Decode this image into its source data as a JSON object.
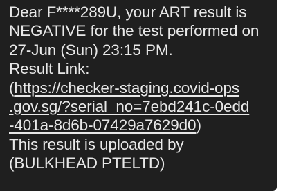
{
  "message": {
    "line1": "Dear F****289U, your ART result is",
    "line2": "NEGATIVE for the test performed on",
    "line3": "27-Jun (Sun) 23:15 PM.",
    "line4": "Result Link:",
    "link_open": "(",
    "link_line1": "https://checker-staging.covid-ops",
    "link_line2": ".gov.sg/?serial_no=7ebd241c-0edd",
    "link_line3": "-401a-8d6b-07429a7629d0",
    "link_close": ")",
    "line8": "This result is uploaded by",
    "line9": "(BULKHEAD PTELTD)"
  },
  "colors": {
    "bubble_background": "#1f1f1f",
    "text": "#e8e8e8"
  }
}
